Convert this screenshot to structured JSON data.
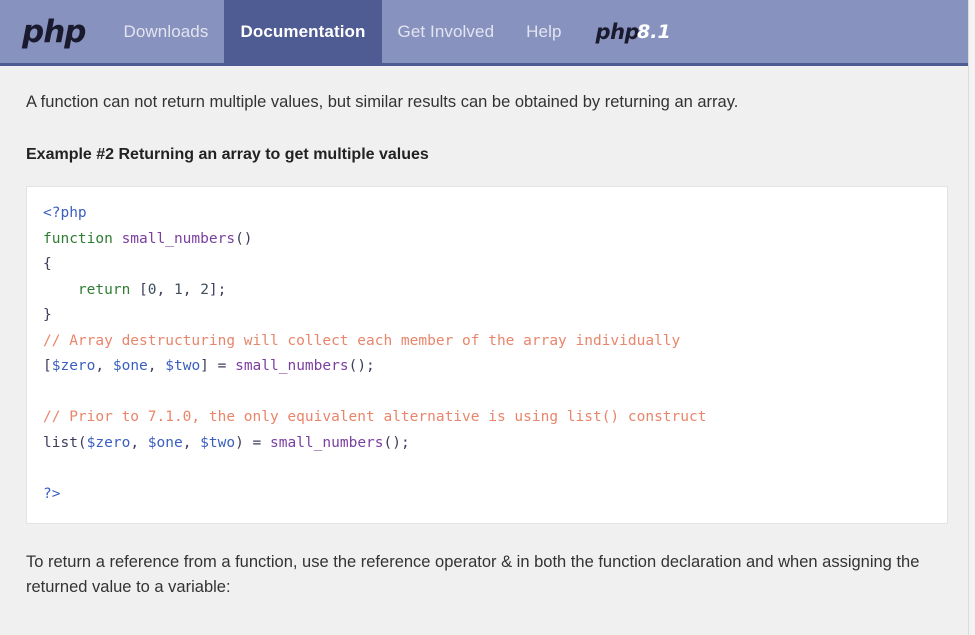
{
  "navbar": {
    "brand_label": "php",
    "links": [
      {
        "label": "Downloads",
        "active": false
      },
      {
        "label": "Documentation",
        "active": true
      },
      {
        "label": "Get Involved",
        "active": false
      },
      {
        "label": "Help",
        "active": false
      }
    ],
    "version_logo": {
      "php_label": "php",
      "version_label": "8.1"
    },
    "colors": {
      "background": "#8892bf",
      "active_tab": "#4f5b93",
      "bottom_border": "#4f5b93",
      "link_text": "#e2e4f0",
      "active_text": "#ffffff"
    }
  },
  "main": {
    "intro_paragraph": "A function can not return multiple values, but similar results can be obtained by returning an array.",
    "example_title": "Example #2 Returning an array to get multiple values",
    "code": {
      "lines": [
        {
          "tokens": [
            {
              "t": "<?php",
              "c": "tok-tag"
            }
          ]
        },
        {
          "tokens": [
            {
              "t": "function",
              "c": "tok-kw"
            },
            {
              "t": " ",
              "c": "tok-plain"
            },
            {
              "t": "small_numbers",
              "c": "tok-fn"
            },
            {
              "t": "()",
              "c": "tok-punct"
            }
          ]
        },
        {
          "tokens": [
            {
              "t": "{",
              "c": "tok-punct"
            }
          ]
        },
        {
          "tokens": [
            {
              "t": "    ",
              "c": "tok-plain"
            },
            {
              "t": "return",
              "c": "tok-kw"
            },
            {
              "t": " ",
              "c": "tok-plain"
            },
            {
              "t": "[",
              "c": "tok-punct"
            },
            {
              "t": "0",
              "c": "tok-num"
            },
            {
              "t": ", ",
              "c": "tok-punct"
            },
            {
              "t": "1",
              "c": "tok-num"
            },
            {
              "t": ", ",
              "c": "tok-punct"
            },
            {
              "t": "2",
              "c": "tok-num"
            },
            {
              "t": "];",
              "c": "tok-punct"
            }
          ]
        },
        {
          "tokens": [
            {
              "t": "}",
              "c": "tok-punct"
            }
          ]
        },
        {
          "tokens": [
            {
              "t": "// Array destructuring will collect each member of the array individually",
              "c": "tok-cmt"
            }
          ]
        },
        {
          "tokens": [
            {
              "t": "[",
              "c": "tok-punct"
            },
            {
              "t": "$zero",
              "c": "tok-var"
            },
            {
              "t": ", ",
              "c": "tok-punct"
            },
            {
              "t": "$one",
              "c": "tok-var"
            },
            {
              "t": ", ",
              "c": "tok-punct"
            },
            {
              "t": "$two",
              "c": "tok-var"
            },
            {
              "t": "] = ",
              "c": "tok-punct"
            },
            {
              "t": "small_numbers",
              "c": "tok-fn"
            },
            {
              "t": "();",
              "c": "tok-punct"
            }
          ]
        },
        {
          "tokens": [
            {
              "t": "",
              "c": "tok-plain"
            }
          ]
        },
        {
          "tokens": [
            {
              "t": "// Prior to 7.1.0, the only equivalent alternative is using list() construct",
              "c": "tok-cmt"
            }
          ]
        },
        {
          "tokens": [
            {
              "t": "list",
              "c": "tok-plain"
            },
            {
              "t": "(",
              "c": "tok-punct"
            },
            {
              "t": "$zero",
              "c": "tok-var"
            },
            {
              "t": ", ",
              "c": "tok-punct"
            },
            {
              "t": "$one",
              "c": "tok-var"
            },
            {
              "t": ", ",
              "c": "tok-punct"
            },
            {
              "t": "$two",
              "c": "tok-var"
            },
            {
              "t": ") = ",
              "c": "tok-punct"
            },
            {
              "t": "small_numbers",
              "c": "tok-fn"
            },
            {
              "t": "();",
              "c": "tok-punct"
            }
          ]
        },
        {
          "tokens": [
            {
              "t": "",
              "c": "tok-plain"
            }
          ]
        },
        {
          "tokens": [
            {
              "t": "?>",
              "c": "tok-tag"
            }
          ]
        }
      ]
    },
    "outro_paragraph": "To return a reference from a function, use the reference operator & in both the function declaration and when assigning the returned value to a variable:"
  },
  "page": {
    "background": "#f0f0f0",
    "code_background": "#ffffff",
    "text_color": "#333333"
  }
}
